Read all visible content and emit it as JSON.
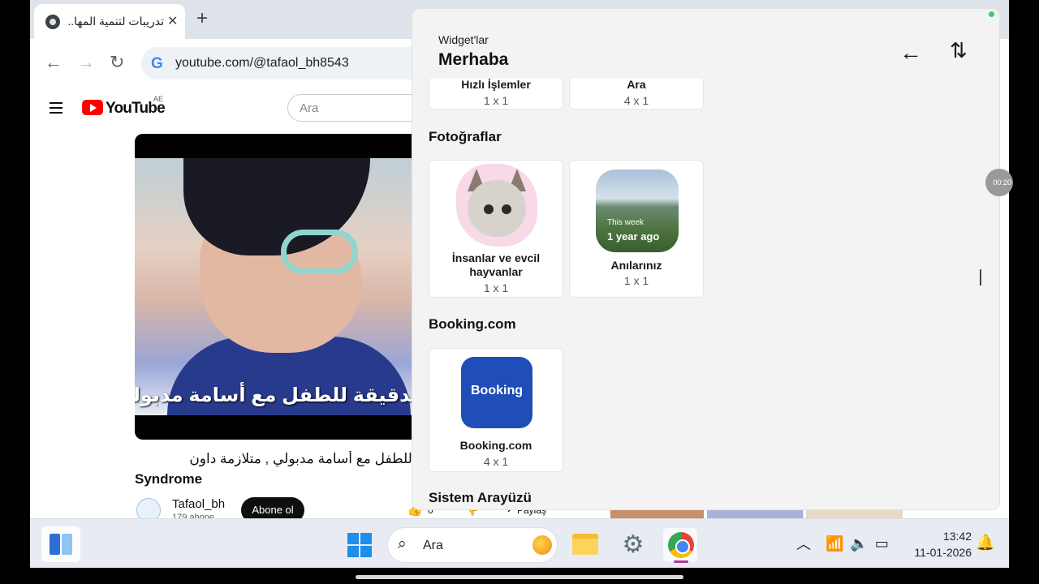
{
  "browser": {
    "tab_title": "تدريبات لتنمية المها...",
    "url": "youtube.com/@tafaol_bh8543",
    "google_glyph": "G"
  },
  "youtube": {
    "logo_text": "YouTube",
    "country": "AE",
    "search_placeholder": "Ara",
    "video_caption": "رات الدقيقة للطفل مع أسامة مدبولي",
    "video_title_line1": "رات الدقيقة للطفل مع أسامة مدبولي , متلازمة داون",
    "video_title_line2": "Syndrome",
    "channel_name": "Tafaol_bh",
    "channel_subs": "179 abone",
    "subscribe_label": "Abone ol",
    "like_count": "0",
    "share_label": "Paylaş"
  },
  "widgets": {
    "subtitle": "Widget'lar",
    "title": "Merhaba",
    "top_cards": [
      {
        "name": "Hızlı İşlemler",
        "size": "1 x 1"
      },
      {
        "name": "Ara",
        "size": "4 x 1"
      }
    ],
    "sections": [
      {
        "title": "Fotoğraflar",
        "cards": [
          {
            "name": "İnsanlar ve evcil hayvanlar",
            "size": "1 x 1"
          },
          {
            "name": "Anılarınız",
            "size": "1 x 1",
            "overlay_week": "This week",
            "overlay_ago": "1 year ago"
          }
        ]
      },
      {
        "title": "Booking.com",
        "cards": [
          {
            "name": "Booking.com",
            "size": "4 x 1",
            "logo_text": "Booking"
          }
        ]
      },
      {
        "title": "Sistem Arayüzü",
        "cards": []
      }
    ]
  },
  "recording_timer": "00:20",
  "taskbar": {
    "search_label": "Ara",
    "time": "13:42",
    "date": "11-01-2026"
  },
  "icons": [
    "chrome-favicon",
    "close-icon",
    "plus-icon",
    "back-arrow-icon",
    "forward-arrow-icon",
    "reload-icon",
    "google-icon",
    "hamburger-menu-icon",
    "youtube-logo",
    "arrow-left-icon",
    "sort-icon",
    "search-icon",
    "windows-start-icon",
    "file-explorer-icon",
    "settings-gear-icon",
    "chrome-icon",
    "chevron-up-icon",
    "wifi-icon",
    "volume-icon",
    "battery-icon",
    "bell-icon"
  ],
  "colors": {
    "accent": "#1f4eb8",
    "youtube_red": "#ff0000",
    "chrome_tabstrip": "#dee3ea",
    "widget_panel": "#f3f3f3",
    "status_dot": "#35d06b"
  }
}
